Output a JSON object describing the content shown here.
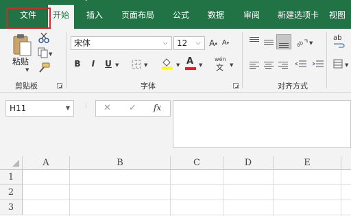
{
  "tabs": {
    "file": "文件",
    "home": "开始",
    "insert": "插入",
    "page_layout": "页面布局",
    "formulas": "公式",
    "data": "数据",
    "review": "审阅",
    "new_tab": "新建选项卡",
    "view": "视图"
  },
  "clipboard": {
    "paste": "粘贴",
    "group_label": "剪贴板"
  },
  "font": {
    "name": "宋体",
    "size": "12",
    "bold": "B",
    "italic": "I",
    "underline": "U",
    "wen": "wén",
    "wen_char": "文",
    "font_color_letter": "A",
    "group_label": "字体"
  },
  "alignment": {
    "group_label": "对齐方式",
    "wrap": "ab"
  },
  "formula_bar": {
    "name_box": "H11",
    "fx": "fx",
    "cancel": "✕",
    "enter": "✓"
  },
  "sheet": {
    "columns": [
      "A",
      "B",
      "C",
      "D",
      "E"
    ],
    "rows": [
      "1",
      "2",
      "3"
    ]
  },
  "colors": {
    "accent": "#217346",
    "highlight": "#ffff00",
    "font_color": "#e02020",
    "annotation": "#e6201e"
  }
}
